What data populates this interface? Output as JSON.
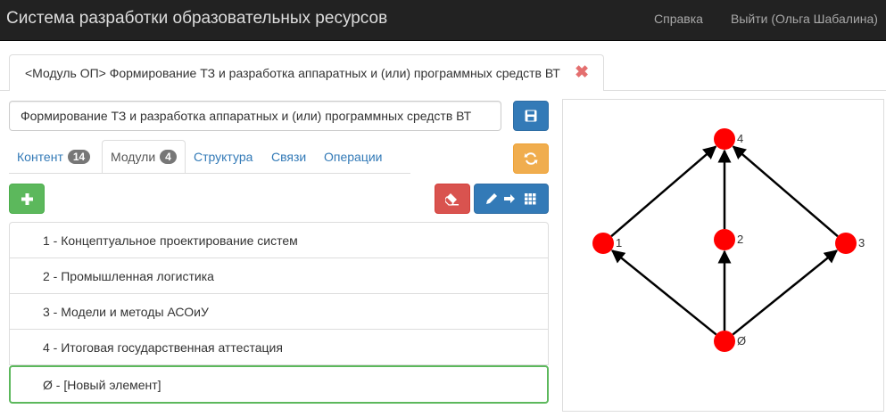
{
  "navbar": {
    "brand": "Система разработки образовательных ресурсов",
    "help": "Справка",
    "logout": "Выйти (Ольга Шабалина)"
  },
  "doc_tab": {
    "label": "<Модуль ОП> Формирование ТЗ и разработка аппаратных и (или) программных средств ВТ",
    "close_icon": "close-icon"
  },
  "name_field": {
    "value": "Формирование ТЗ и разработка аппаратных и (или) программных средств ВТ"
  },
  "tabs": [
    {
      "label": "Контент",
      "badge": "14",
      "active": false
    },
    {
      "label": "Модули",
      "badge": "4",
      "active": true
    },
    {
      "label": "Структура",
      "badge": null,
      "active": false
    },
    {
      "label": "Связи",
      "badge": null,
      "active": false
    },
    {
      "label": "Операции",
      "badge": null,
      "active": false
    }
  ],
  "icons": {
    "save": "save-icon",
    "refresh": "refresh-icon",
    "add": "plus-icon",
    "erase": "eraser-icon",
    "edit_to_grid": "pencil-arrow-grid-icon"
  },
  "colors": {
    "navbar": "#222222",
    "primary": "#337ab7",
    "warning": "#f0ad4e",
    "success": "#5cb85c",
    "danger": "#d9534f",
    "graph_node": "#ff0000"
  },
  "modules": [
    {
      "label": "1 - Концептуальное проектирование систем",
      "selected": false
    },
    {
      "label": "2 - Промышленная логистика",
      "selected": false
    },
    {
      "label": "3 - Модели и методы АСОиУ",
      "selected": false
    },
    {
      "label": "4 - Итоговая государственная аттестация",
      "selected": false
    },
    {
      "label": "Ø - [Новый элемент]",
      "selected": true
    }
  ],
  "graph": {
    "nodes": [
      {
        "id": "4",
        "label": "4"
      },
      {
        "id": "1",
        "label": "1"
      },
      {
        "id": "2",
        "label": "2"
      },
      {
        "id": "3",
        "label": "3"
      },
      {
        "id": "0",
        "label": "Ø"
      }
    ],
    "edges": [
      {
        "from": "0",
        "to": "1"
      },
      {
        "from": "0",
        "to": "2"
      },
      {
        "from": "0",
        "to": "3"
      },
      {
        "from": "1",
        "to": "4"
      },
      {
        "from": "2",
        "to": "4"
      },
      {
        "from": "3",
        "to": "4"
      }
    ]
  }
}
